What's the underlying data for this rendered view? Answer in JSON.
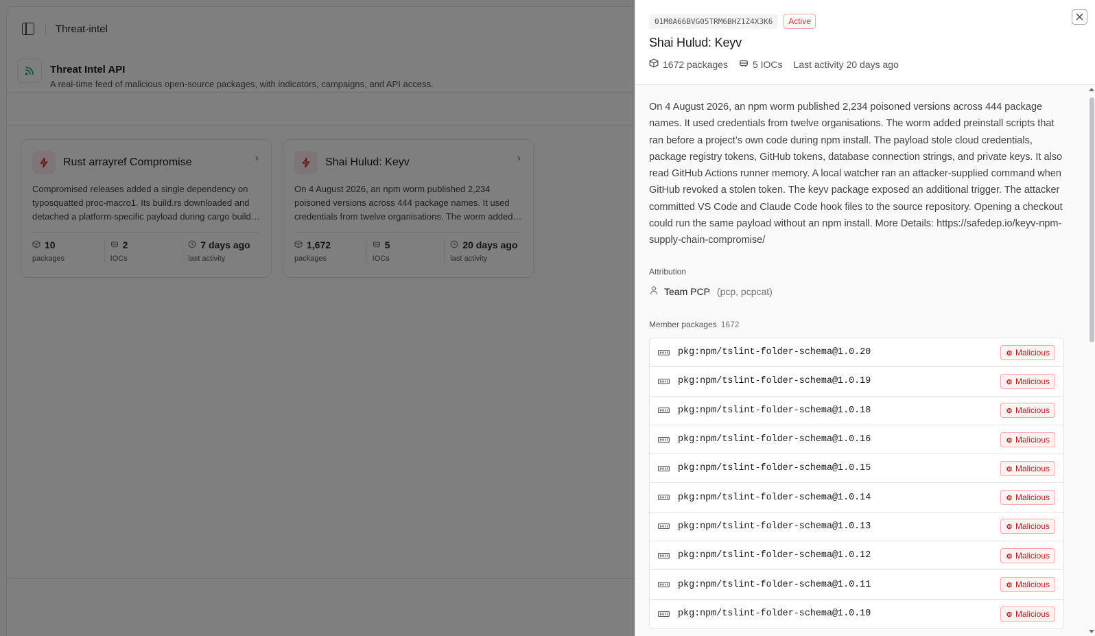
{
  "app": {
    "breadcrumb": "Threat-intel",
    "page_title": "Threat Intel API",
    "page_subtitle": "A real-time feed of malicious open-source packages, with indicators, campaigns, and API access.",
    "cards": [
      {
        "title": "Rust arrayref Compromise",
        "description": "Compromised releases added a single dependency on typosquatted proc-macro1. Its build.rs downloaded and detached a platform-specific payload during cargo build; the payload stole credentials.",
        "stats": [
          {
            "value": "10",
            "label": "packages",
            "icon": "package-icon"
          },
          {
            "value": "2",
            "label": "IOCs",
            "icon": "ioc-icon"
          },
          {
            "value": "7 days ago",
            "label": "last activity",
            "icon": "clock-icon"
          }
        ]
      },
      {
        "title": "Shai Hulud: Keyv",
        "description": "On 4 August 2026, an npm worm published 2,234 poisoned versions across 444 package names. It used credentials from twelve organisations. The worm added preinstall scripts.",
        "stats": [
          {
            "value": "1,672",
            "label": "packages",
            "icon": "package-icon"
          },
          {
            "value": "5",
            "label": "IOCs",
            "icon": "ioc-icon"
          },
          {
            "value": "20 days ago",
            "label": "last activity",
            "icon": "clock-icon"
          }
        ]
      }
    ]
  },
  "drawer": {
    "id": "01M0A66BVG05TRM6BHZ1Z4X3K6",
    "status": "Active",
    "title": "Shai Hulud: Keyv",
    "meta": {
      "packages": "1672 packages",
      "iocs": "5 IOCs",
      "last_activity": "Last activity 20 days ago"
    },
    "description": "On 4 August 2026, an npm worm published 2,234 poisoned versions across 444 package names. It used credentials from twelve organisations. The worm added preinstall scripts that ran before a project’s own code during npm install. The payload stole cloud credentials, package registry tokens, GitHub tokens, database connection strings, and private keys. It also read GitHub Actions runner memory. A local watcher ran an attacker-supplied command when GitHub revoked a stolen token. The keyv package exposed an additional trigger. The attacker committed VS Code and Claude Code hook files to the source repository. Opening a checkout could run the same payload without an npm install. More Details: https://safedep.io/keyv-npm-supply-chain-compromise/",
    "attribution": {
      "label": "Attribution",
      "name": "Team PCP",
      "aliases": "(pcp, pcpcat)"
    },
    "members": {
      "label": "Member packages",
      "count": "1672",
      "badge_label": "Malicious",
      "items": [
        "pkg:npm/tslint-folder-schema@1.0.20",
        "pkg:npm/tslint-folder-schema@1.0.19",
        "pkg:npm/tslint-folder-schema@1.0.18",
        "pkg:npm/tslint-folder-schema@1.0.16",
        "pkg:npm/tslint-folder-schema@1.0.15",
        "pkg:npm/tslint-folder-schema@1.0.14",
        "pkg:npm/tslint-folder-schema@1.0.13",
        "pkg:npm/tslint-folder-schema@1.0.12",
        "pkg:npm/tslint-folder-schema@1.0.11",
        "pkg:npm/tslint-folder-schema@1.0.10"
      ]
    }
  },
  "colors": {
    "danger": "#dc2626",
    "overlay": "#000000"
  }
}
